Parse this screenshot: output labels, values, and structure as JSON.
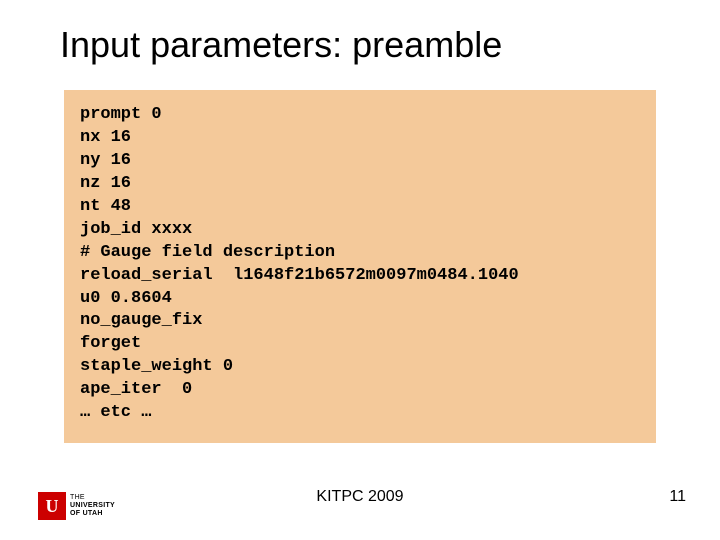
{
  "title": "Input parameters: preamble",
  "code_lines": [
    "prompt 0",
    "nx 16",
    "ny 16",
    "nz 16",
    "nt 48",
    "job_id xxxx",
    "# Gauge field description",
    "reload_serial  l1648f21b6572m0097m0484.1040",
    "u0 0.8604",
    "no_gauge_fix",
    "forget",
    "staple_weight 0",
    "ape_iter  0",
    "… etc …"
  ],
  "footer": {
    "center": "KITPC 2009",
    "page": "11"
  },
  "logo": {
    "glyph": "U",
    "line1": "THE",
    "line2": "UNIVERSITY",
    "line3": "OF UTAH"
  }
}
